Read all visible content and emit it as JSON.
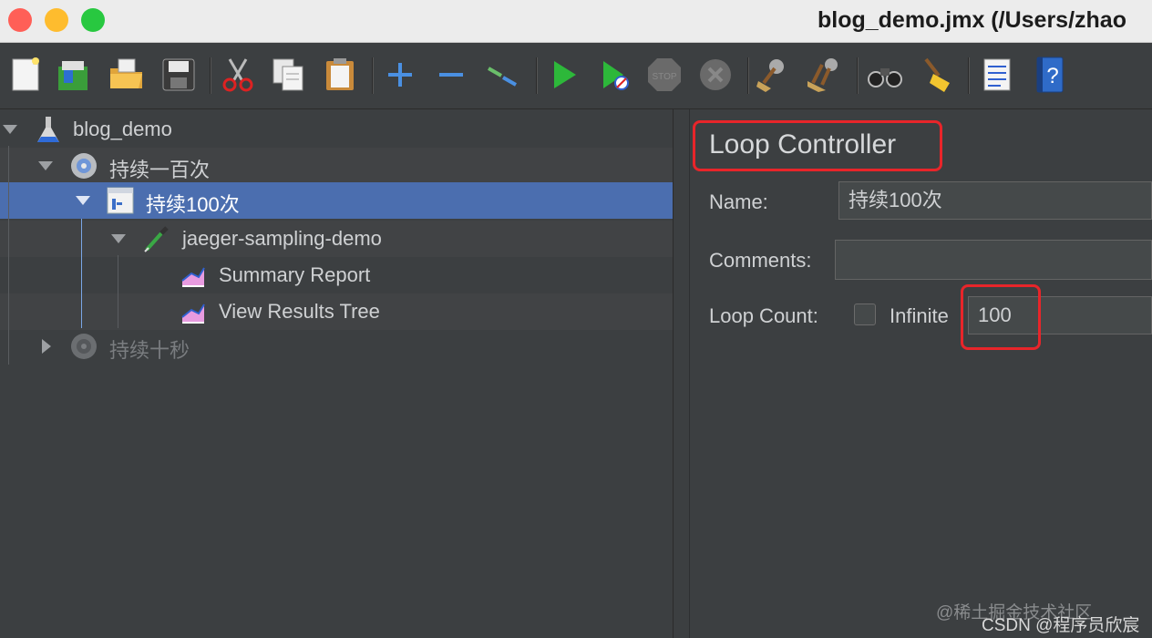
{
  "window": {
    "title": "blog_demo.jmx (/Users/zhao"
  },
  "toolbar": {
    "icons": [
      "new-icon",
      "templates-icon",
      "open-icon",
      "save-icon",
      "cut-icon",
      "copy-icon",
      "paste-icon",
      "expand-icon",
      "collapse-icon",
      "toggle-icon",
      "start-icon",
      "start-no-pauses-icon",
      "stop-icon",
      "shutdown-icon",
      "clear-icon",
      "clear-all-icon",
      "search-icon",
      "reset-search-icon",
      "function-helper-icon",
      "help-icon"
    ]
  },
  "tree": {
    "items": [
      {
        "label": "blog_demo",
        "icon": "test-plan-flask-icon"
      },
      {
        "label": "持续一百次",
        "icon": "thread-group-gear-icon"
      },
      {
        "label": "持续100次",
        "icon": "loop-controller-icon"
      },
      {
        "label": "jaeger-sampling-demo",
        "icon": "sampler-pipette-icon"
      },
      {
        "label": "Summary Report",
        "icon": "listener-chart-icon"
      },
      {
        "label": "View Results Tree",
        "icon": "listener-chart-icon"
      },
      {
        "label": "持续十秒",
        "icon": "thread-group-gear-icon"
      }
    ]
  },
  "panel": {
    "title": "Loop Controller",
    "name_label": "Name:",
    "name_value": "持续100次",
    "comments_label": "Comments:",
    "comments_value": "",
    "loop_count_label": "Loop Count:",
    "infinite_label": "Infinite",
    "infinite_checked": false,
    "loop_count_value": "100"
  },
  "watermark": {
    "line1": "@稀土掘金技术社区",
    "line2": "CSDN @程序员欣宸"
  },
  "colors": {
    "selection": "#4b6eaf",
    "highlight": "#e8252a",
    "panel_bg": "#3c3f41"
  }
}
